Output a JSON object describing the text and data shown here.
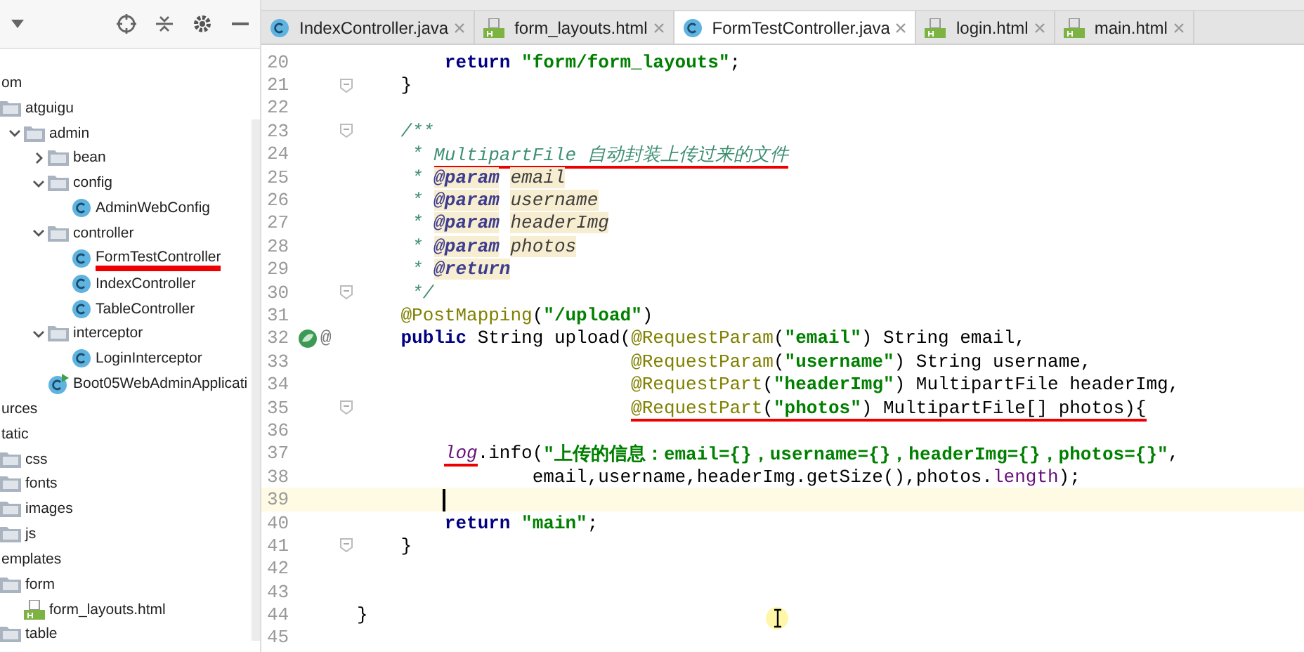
{
  "tree": [
    {
      "label": "om",
      "kind": "text",
      "children": [
        {
          "label": "atguigu",
          "kind": "folder",
          "children": [
            {
              "label": "admin",
              "kind": "folder",
              "expanded": true,
              "children": [
                {
                  "label": "bean",
                  "kind": "folder",
                  "expanded": false
                },
                {
                  "label": "config",
                  "kind": "folder",
                  "expanded": true,
                  "children": [
                    {
                      "label": "AdminWebConfig",
                      "kind": "class"
                    }
                  ]
                },
                {
                  "label": "controller",
                  "kind": "folder",
                  "expanded": true,
                  "children": [
                    {
                      "label": "FormTestController",
                      "kind": "class",
                      "underline": true
                    },
                    {
                      "label": "IndexController",
                      "kind": "class"
                    },
                    {
                      "label": "TableController",
                      "kind": "class"
                    }
                  ]
                },
                {
                  "label": "interceptor",
                  "kind": "folder",
                  "expanded": true,
                  "children": [
                    {
                      "label": "LoginInterceptor",
                      "kind": "class"
                    }
                  ]
                },
                {
                  "label": "Boot05WebAdminApplicati",
                  "kind": "app"
                }
              ]
            }
          ]
        }
      ]
    },
    {
      "label": "urces",
      "kind": "text"
    },
    {
      "label": "tatic",
      "kind": "text",
      "children": [
        {
          "label": "css",
          "kind": "folder"
        },
        {
          "label": "fonts",
          "kind": "folder"
        },
        {
          "label": "images",
          "kind": "folder"
        },
        {
          "label": "js",
          "kind": "folder"
        }
      ]
    },
    {
      "label": "emplates",
      "kind": "text",
      "children": [
        {
          "label": "form",
          "kind": "folder",
          "children": [
            {
              "label": "form_layouts.html",
              "kind": "html"
            }
          ]
        },
        {
          "label": "table",
          "kind": "folder"
        }
      ]
    }
  ],
  "tabs": [
    {
      "label": "IndexController.java",
      "kind": "class",
      "selected": false
    },
    {
      "label": "form_layouts.html",
      "kind": "html",
      "selected": false
    },
    {
      "label": "FormTestController.java",
      "kind": "class",
      "selected": true
    },
    {
      "label": "login.html",
      "kind": "html",
      "selected": false
    },
    {
      "label": "main.html",
      "kind": "html",
      "selected": false
    }
  ],
  "lines": [
    {
      "number": "20",
      "tokens": [
        {
          "kind": "kw",
          "text": "        return"
        },
        {
          "kind": "str",
          "text": " \"form/form_layouts\""
        },
        {
          "kind": "plain",
          "text": ";"
        }
      ]
    },
    {
      "number": "21",
      "fold": true,
      "tokens": [
        {
          "kind": "plain",
          "text": "    }"
        }
      ]
    },
    {
      "number": "22"
    },
    {
      "number": "23",
      "fold": true,
      "tokens": [
        {
          "kind": "doc",
          "text": "    /**"
        }
      ]
    },
    {
      "number": "24",
      "tokens": [
        {
          "kind": "doc",
          "text": "     * "
        },
        {
          "kind": "doc",
          "text": "MultipartFile 自动封装上传过来的文件",
          "underline": true
        }
      ]
    },
    {
      "number": "25",
      "tokens": [
        {
          "kind": "doc",
          "text": "     * "
        },
        {
          "kind": "doctag",
          "text": "@param"
        },
        {
          "kind": "docparam",
          "text": "email"
        }
      ]
    },
    {
      "number": "26",
      "tokens": [
        {
          "kind": "doc",
          "text": "     * "
        },
        {
          "kind": "doctag",
          "text": "@param"
        },
        {
          "kind": "docparam",
          "text": "username"
        }
      ]
    },
    {
      "number": "27",
      "tokens": [
        {
          "kind": "doc",
          "text": "     * "
        },
        {
          "kind": "doctag",
          "text": "@param"
        },
        {
          "kind": "docparam",
          "text": "headerImg"
        }
      ]
    },
    {
      "number": "28",
      "tokens": [
        {
          "kind": "doc",
          "text": "     * "
        },
        {
          "kind": "doctag",
          "text": "@param"
        },
        {
          "kind": "docparam",
          "text": "photos"
        }
      ]
    },
    {
      "number": "29",
      "tokens": [
        {
          "kind": "doc",
          "text": "     * "
        },
        {
          "kind": "doctag",
          "text": "@return"
        }
      ]
    },
    {
      "number": "30",
      "fold": true,
      "tokens": [
        {
          "kind": "doc",
          "text": "     */"
        }
      ]
    },
    {
      "number": "31",
      "tokens": [
        {
          "kind": "ann",
          "text": "    @PostMapping"
        },
        {
          "kind": "plain",
          "text": "("
        },
        {
          "kind": "str",
          "text": "\"/upload\""
        },
        {
          "kind": "plain",
          "text": ")"
        }
      ]
    },
    {
      "number": "32",
      "run_icon": true,
      "gutter_text": "@",
      "tokens": [
        {
          "kind": "kw",
          "text": "    public"
        },
        {
          "kind": "plain",
          "text": " String upload("
        },
        {
          "kind": "ann",
          "text": "@RequestParam"
        },
        {
          "kind": "plain",
          "text": "("
        },
        {
          "kind": "str",
          "text": "\"email\""
        },
        {
          "kind": "plain",
          "text": ") String email,"
        }
      ]
    },
    {
      "number": "33",
      "tokens": [
        {
          "kind": "ann",
          "text": "                         @RequestParam"
        },
        {
          "kind": "plain",
          "text": "("
        },
        {
          "kind": "str",
          "text": "\"username\""
        },
        {
          "kind": "plain",
          "text": ") String username,"
        }
      ]
    },
    {
      "number": "34",
      "tokens": [
        {
          "kind": "ann",
          "text": "                         @RequestPart"
        },
        {
          "kind": "plain",
          "text": "("
        },
        {
          "kind": "str",
          "text": "\"headerImg\""
        },
        {
          "kind": "plain",
          "text": ") MultipartFile headerImg,"
        }
      ]
    },
    {
      "number": "35",
      "fold": true,
      "tokens": [
        {
          "kind": "ann",
          "text": "                         @RequestPart",
          "underline": true
        },
        {
          "kind": "plain",
          "text": "(",
          "underline": true
        },
        {
          "kind": "str",
          "text": "\"photos\"",
          "underline": true
        },
        {
          "kind": "plain",
          "text": ") MultipartFile[] photos){",
          "underline": true
        }
      ]
    },
    {
      "number": "36"
    },
    {
      "number": "37",
      "tokens": [
        {
          "kind": "logvar",
          "text": "        log",
          "underline": true
        },
        {
          "kind": "plain",
          "text": ".info("
        },
        {
          "kind": "str",
          "text": "\"上传的信息：email={}，username={}，headerImg={}，photos={}\""
        },
        {
          "kind": "plain",
          "text": ","
        }
      ]
    },
    {
      "number": "38",
      "tokens": [
        {
          "kind": "plain",
          "text": "                email,username,headerImg.getSize(),photos."
        },
        {
          "kind": "field",
          "text": "length"
        },
        {
          "kind": "plain",
          "text": ");"
        }
      ]
    },
    {
      "number": "39",
      "current": true
    },
    {
      "number": "40",
      "tokens": [
        {
          "kind": "kw",
          "text": "        return"
        },
        {
          "kind": "str",
          "text": " \"main\""
        },
        {
          "kind": "plain",
          "text": ";"
        }
      ]
    },
    {
      "number": "41",
      "fold": true,
      "tokens": [
        {
          "kind": "plain",
          "text": "    }"
        }
      ]
    },
    {
      "number": "42"
    },
    {
      "number": "43"
    },
    {
      "number": "44",
      "tokens": [
        {
          "kind": "plain",
          "text": "}"
        }
      ]
    },
    {
      "number": "45"
    }
  ]
}
